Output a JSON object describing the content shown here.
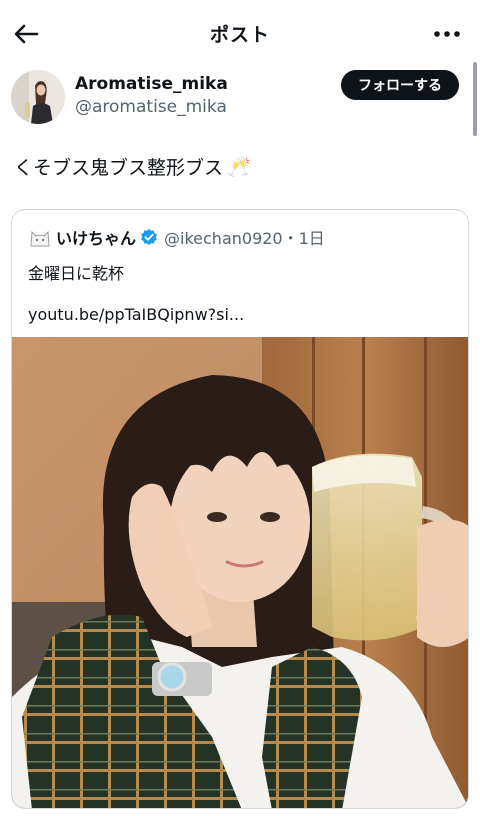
{
  "header": {
    "title": "ポスト",
    "back_icon": "arrow-left-icon",
    "more_icon": "more-dots-icon"
  },
  "author": {
    "name": "Aromatise_mika",
    "handle": "@aromatise_mika",
    "follow_label": "フォローする"
  },
  "post": {
    "text": "くそブス鬼ブス整形ブス",
    "emoji": "🥂"
  },
  "quote": {
    "name": "いけちゃん",
    "handle_time": "@ikechan0920・1日",
    "text_line1": "金曜日に乾杯",
    "text_line2": "youtu.be/ppTaIBQipnw?si..."
  },
  "colors": {
    "text_primary": "#0f1419",
    "text_secondary": "#536471",
    "verified_blue": "#1d9bf0",
    "follow_bg": "#0f1419",
    "card_border": "#cfd9de"
  }
}
